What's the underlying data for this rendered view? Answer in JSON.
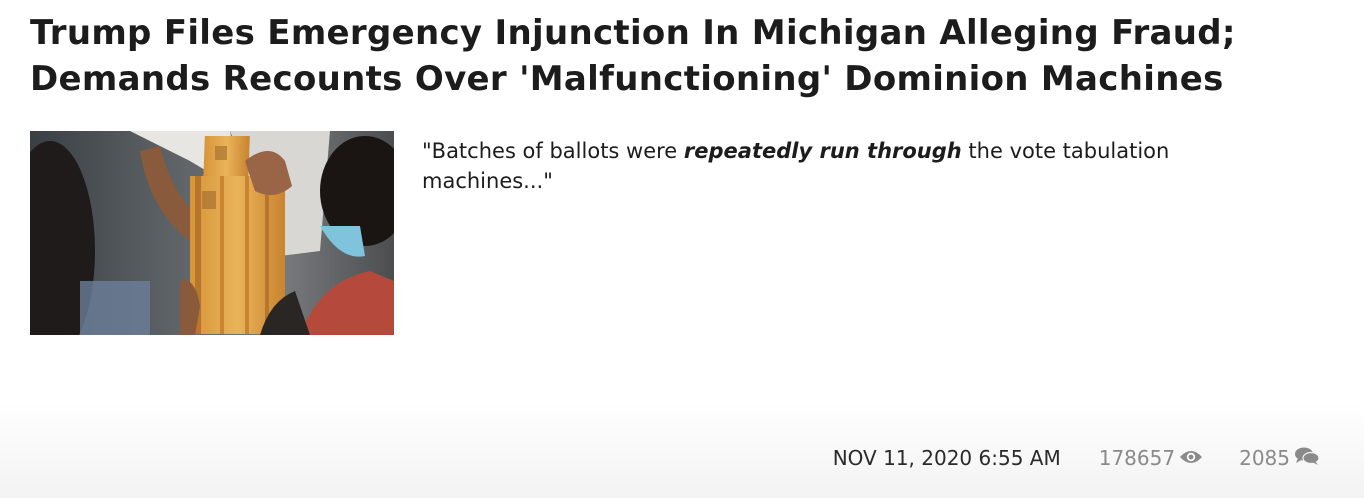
{
  "article": {
    "headline_line1": "Trump Files Emergency Injunction In Michigan Alleging Fraud;",
    "headline_line2": "Demands Recounts Over 'Malfunctioning' Dominion Machines",
    "teaser_before": "\"Batches of ballots were ",
    "teaser_emphasis": "repeatedly run through",
    "teaser_after": " the vote tabulation machines...\"",
    "image": "photo-ballot-envelopes"
  },
  "meta": {
    "date": "NOV 11, 2020 6:55 AM",
    "views": "178657",
    "views_icon": "eye-icon",
    "comments": "2085",
    "comments_icon": "comment-bubbles-icon"
  },
  "colors": {
    "headline": "#1c1c1c",
    "meta_muted": "#8a8a8a",
    "envelope": "#e2a54a"
  }
}
